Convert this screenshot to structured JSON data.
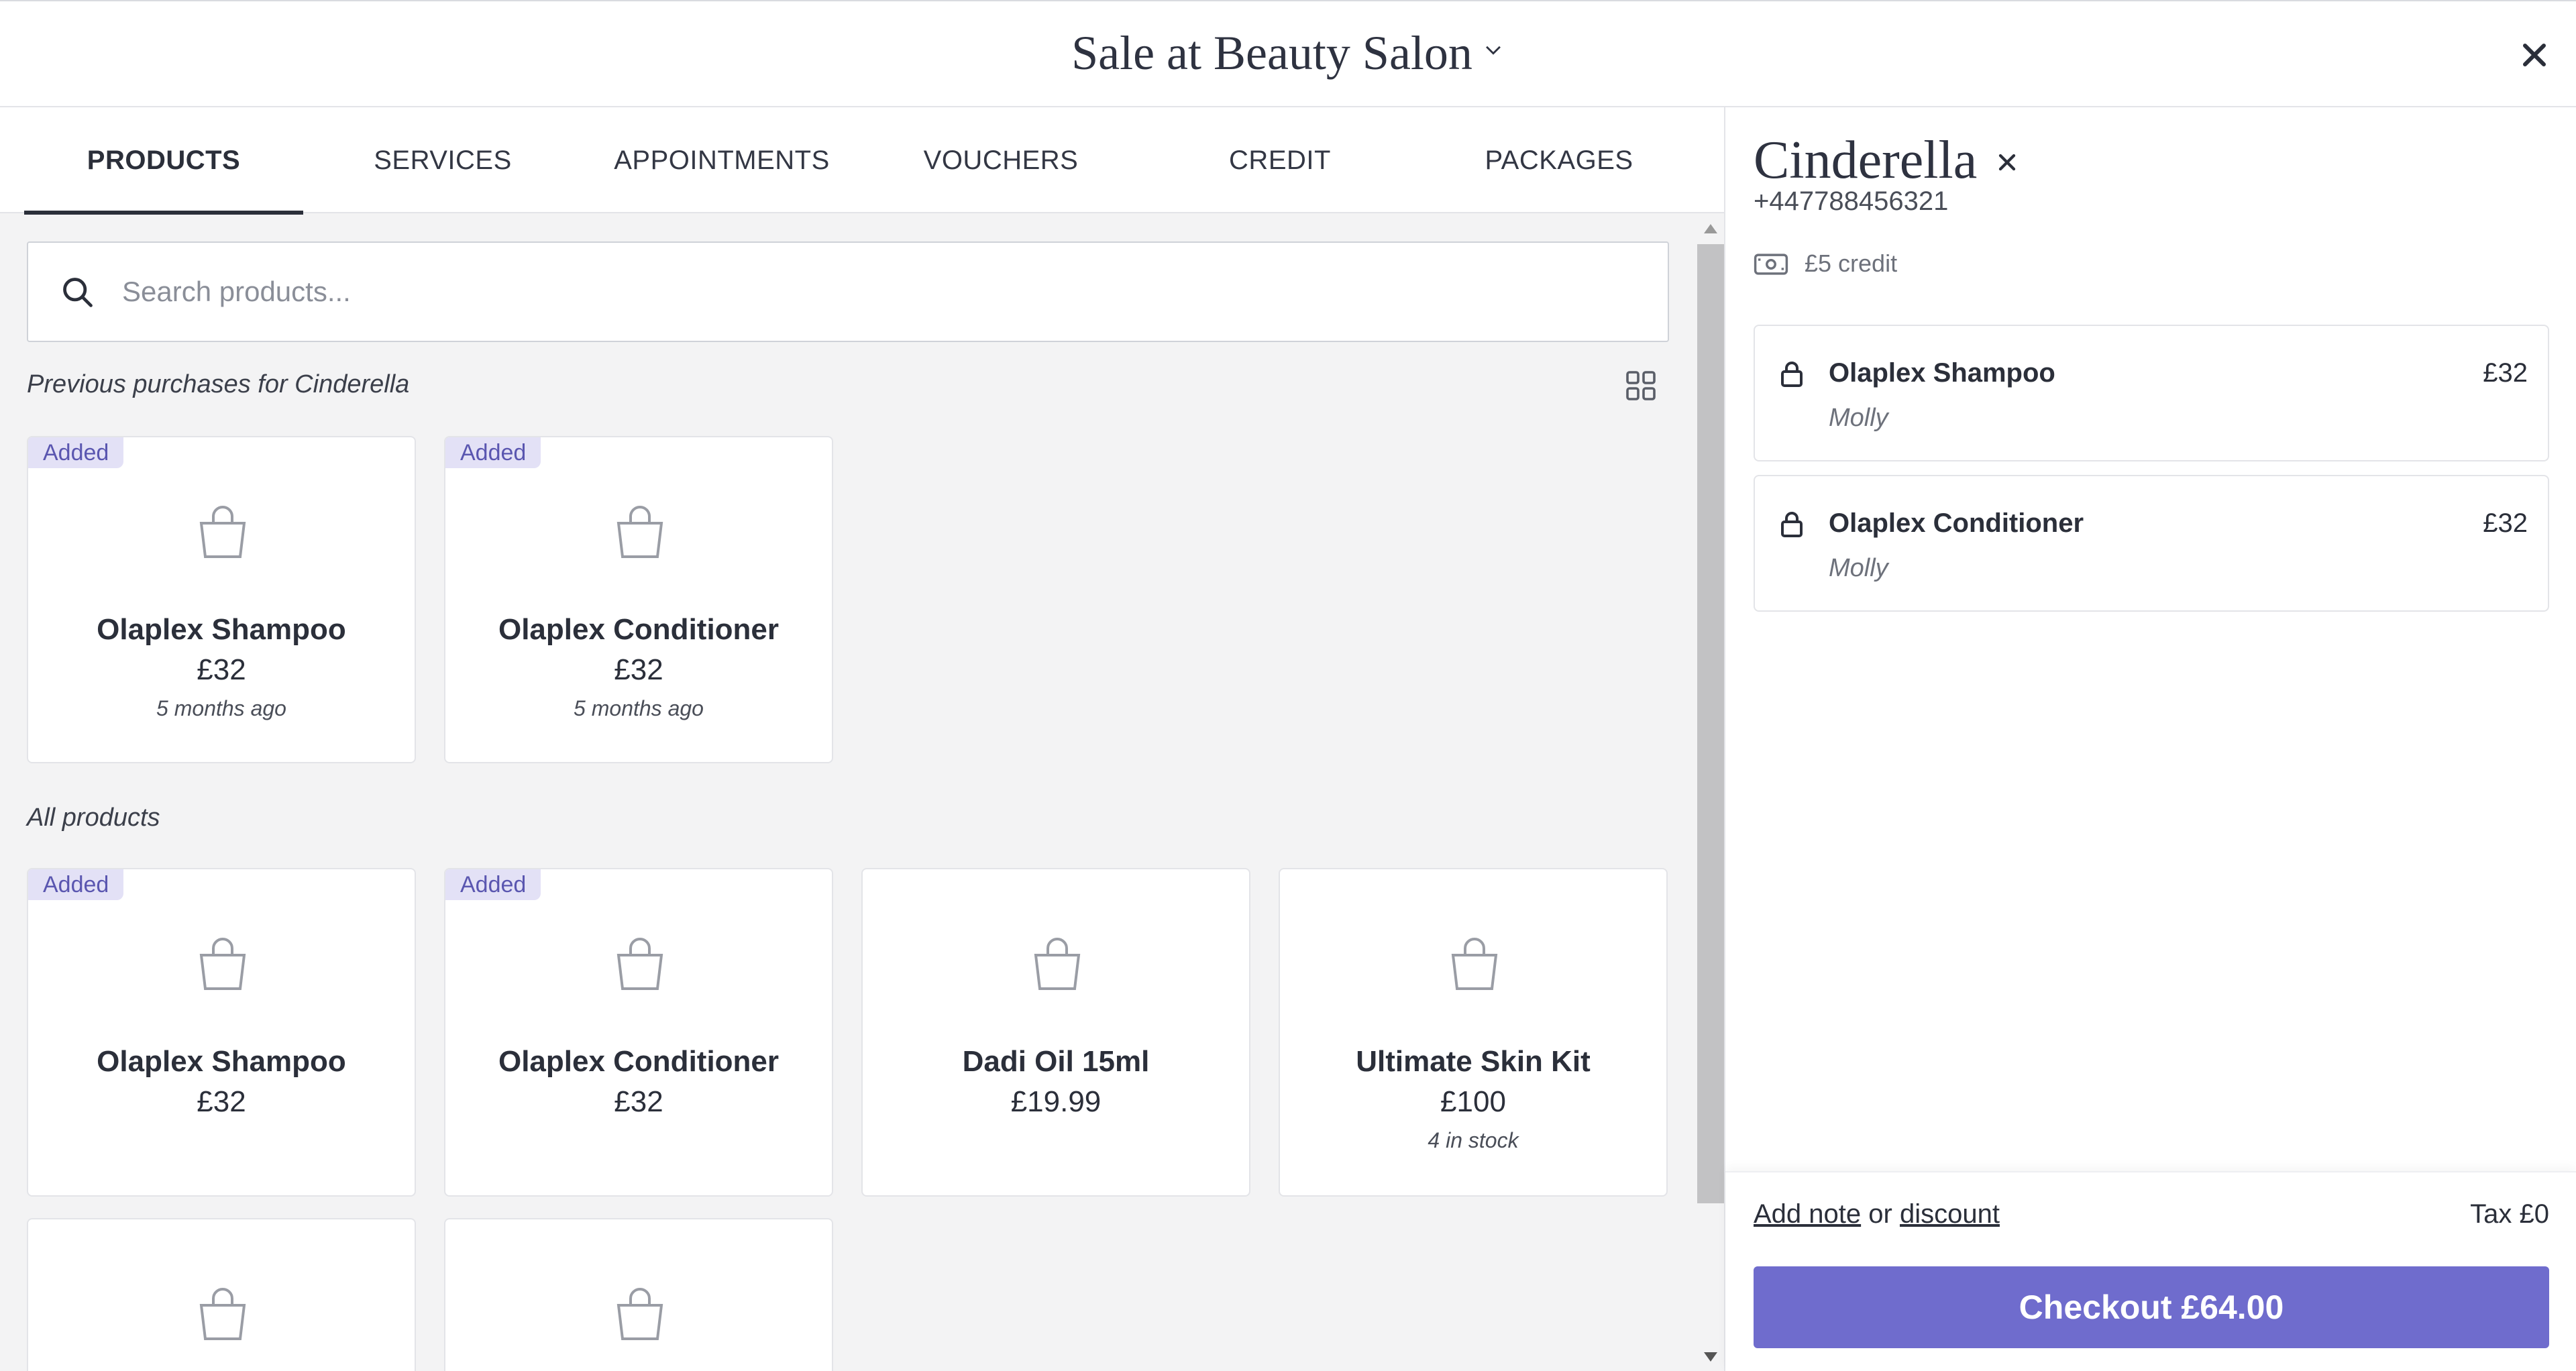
{
  "header": {
    "title": "Sale at Beauty Salon"
  },
  "tabs": [
    {
      "label": "PRODUCTS"
    },
    {
      "label": "SERVICES"
    },
    {
      "label": "APPOINTMENTS"
    },
    {
      "label": "VOUCHERS"
    },
    {
      "label": "CREDIT"
    },
    {
      "label": "PACKAGES"
    }
  ],
  "active_tab": "PRODUCTS",
  "search": {
    "placeholder": "Search products...",
    "value": ""
  },
  "previous": {
    "label": "Previous purchases for Cinderella",
    "items": [
      {
        "badge": "Added",
        "name": "Olaplex Shampoo",
        "price": "£32",
        "meta": "5 months ago"
      },
      {
        "badge": "Added",
        "name": "Olaplex Conditioner",
        "price": "£32",
        "meta": "5 months ago"
      }
    ]
  },
  "all_products": {
    "label": "All products",
    "items": [
      {
        "badge": "Added",
        "name": "Olaplex Shampoo",
        "price": "£32"
      },
      {
        "badge": "Added",
        "name": "Olaplex Conditioner",
        "price": "£32"
      },
      {
        "name": "Dadi Oil 15ml",
        "price": "£19.99"
      },
      {
        "name": "Ultimate Skin Kit",
        "price": "£100",
        "meta": "4 in stock"
      }
    ]
  },
  "client": {
    "name": "Cinderella",
    "phone": "+447788456321",
    "credit": "£5 credit"
  },
  "cart": {
    "items": [
      {
        "name": "Olaplex Shampoo",
        "staff": "Molly",
        "price": "£32"
      },
      {
        "name": "Olaplex Conditioner",
        "staff": "Molly",
        "price": "£32"
      }
    ]
  },
  "footer": {
    "add_note": "Add note",
    "or": "or",
    "discount": "discount",
    "tax": "Tax £0",
    "checkout": "Checkout £64.00"
  },
  "colors": {
    "accent": "#6f6ccd",
    "badge_bg": "#e3e1f6",
    "badge_text": "#5a56b0",
    "panel_bg": "#f3f3f4"
  },
  "icons": [
    "chevron-down-icon",
    "close-icon",
    "search-icon",
    "grid-view-icon",
    "shopping-bag-icon",
    "cash-icon",
    "lock-icon"
  ]
}
